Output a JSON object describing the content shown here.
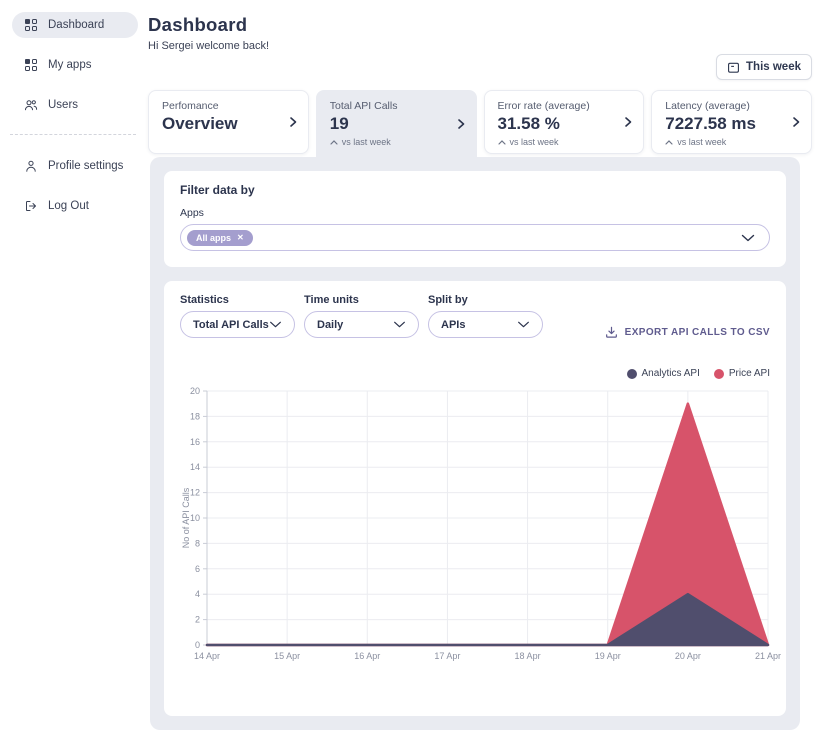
{
  "sidebar": {
    "items": [
      {
        "label": "Dashboard",
        "icon": "grid-icon",
        "active": true
      },
      {
        "label": "My apps",
        "icon": "grid-icon",
        "active": false
      },
      {
        "label": "Users",
        "icon": "users-icon",
        "active": false
      },
      {
        "label": "Profile settings",
        "icon": "user-icon",
        "active": false
      },
      {
        "label": "Log Out",
        "icon": "logout-icon",
        "active": false
      }
    ]
  },
  "header": {
    "title": "Dashboard",
    "greeting": "Hi Sergei welcome back!"
  },
  "toolbar": {
    "date_range_label": "This week",
    "date_range_icon": "calendar-icon"
  },
  "stat_cards": [
    {
      "label": "Perfomance",
      "value": "Overview",
      "selected": false
    },
    {
      "label": "Total API Calls",
      "value": "19",
      "trend_label": "vs last week",
      "trend_icon": "caret-up-icon",
      "selected": true
    },
    {
      "label": "Error rate (average)",
      "value": "31.58 %",
      "trend_label": "vs last week",
      "trend_icon": "caret-up-icon",
      "selected": false
    },
    {
      "label": "Latency (average)",
      "value": "7227.58 ms",
      "trend_label": "vs last week",
      "trend_icon": "caret-up-icon",
      "selected": false
    }
  ],
  "filter": {
    "title": "Filter data by",
    "field_label": "Apps",
    "selected_chip": "All apps",
    "chip_remove_icon": "x-icon"
  },
  "controls": {
    "selects": [
      {
        "label": "Statistics",
        "value": "Total API Calls"
      },
      {
        "label": "Time units",
        "value": "Daily"
      },
      {
        "label": "Split by",
        "value": "APIs"
      }
    ],
    "export_label": "EXPORT API CALLS TO CSV",
    "export_icon": "download-icon"
  },
  "chart_data": {
    "type": "area",
    "stacked": true,
    "x": [
      "14 Apr",
      "15 Apr",
      "16 Apr",
      "17 Apr",
      "18 Apr",
      "19 Apr",
      "20 Apr",
      "21 Apr"
    ],
    "series": [
      {
        "name": "Analytics API",
        "color": "#504e6d",
        "values": [
          0,
          0,
          0,
          0,
          0,
          0,
          4,
          0
        ]
      },
      {
        "name": "Price API",
        "color": "#d7536a",
        "values": [
          0,
          0,
          0,
          0,
          0,
          0,
          15,
          0
        ]
      }
    ],
    "title": "",
    "xlabel": "",
    "ylabel": "No of API Calls",
    "ylim": [
      0,
      20
    ],
    "ytick_step": 2,
    "grid": true,
    "legend_position": "top-right"
  },
  "colors": {
    "panel_bg": "#e9ebf1",
    "chip_bg": "#a49ece",
    "select_border": "#c6c2e4",
    "export_link": "#5f5b8e",
    "text_primary": "#2c344d",
    "text_muted": "#6d7486",
    "analytics_api": "#504e6d",
    "price_api": "#d7536a"
  }
}
